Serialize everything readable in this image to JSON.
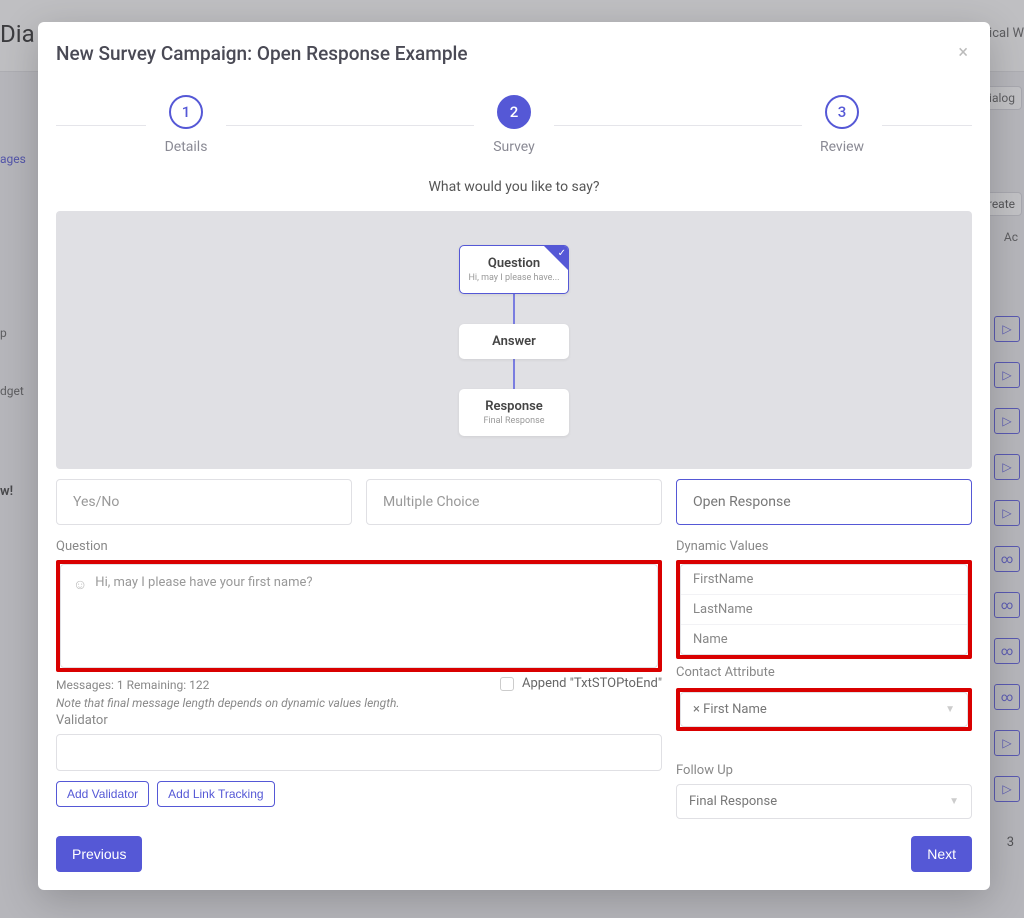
{
  "bg": {
    "title": "Dia",
    "rightTab": "Dialog",
    "createBtn": "Create",
    "acLabel": "Ac",
    "side": {
      "ages": "ages",
      "dget": "dget",
      "w": "w!",
      "p": "p",
      "icalw": "ical W"
    },
    "rowNum": "3"
  },
  "modal": {
    "title": "New Survey Campaign: Open Response Example",
    "close": "×"
  },
  "steps": {
    "s1": {
      "num": "1",
      "label": "Details"
    },
    "s2": {
      "num": "2",
      "label": "Survey"
    },
    "s3": {
      "num": "3",
      "label": "Review"
    }
  },
  "prompt": "What would you like to say?",
  "nodes": {
    "question": {
      "title": "Question",
      "sub": "Hi, may I please have..."
    },
    "answer": {
      "title": "Answer"
    },
    "response": {
      "title": "Response",
      "sub": "Final Response"
    }
  },
  "types": {
    "yesno": "Yes/No",
    "multiple": "Multiple Choice",
    "open": "Open Response"
  },
  "question": {
    "label": "Question",
    "placeholder": "Hi, may I please have your first name?",
    "counter": "Messages: 1 Remaining: 122",
    "note": "Note that final message length depends on dynamic values length.",
    "append": "Append \"TxtSTOPtoEnd\""
  },
  "validator": {
    "label": "Validator",
    "addValidator": "Add Validator",
    "addLink": "Add Link Tracking"
  },
  "dynamic": {
    "label": "Dynamic Values",
    "items": [
      "FirstName",
      "LastName",
      "Name"
    ]
  },
  "contactAttr": {
    "label": "Contact Attribute",
    "value": "× First Name"
  },
  "followup": {
    "label": "Follow Up",
    "value": "Final Response"
  },
  "footer": {
    "prev": "Previous",
    "next": "Next"
  }
}
